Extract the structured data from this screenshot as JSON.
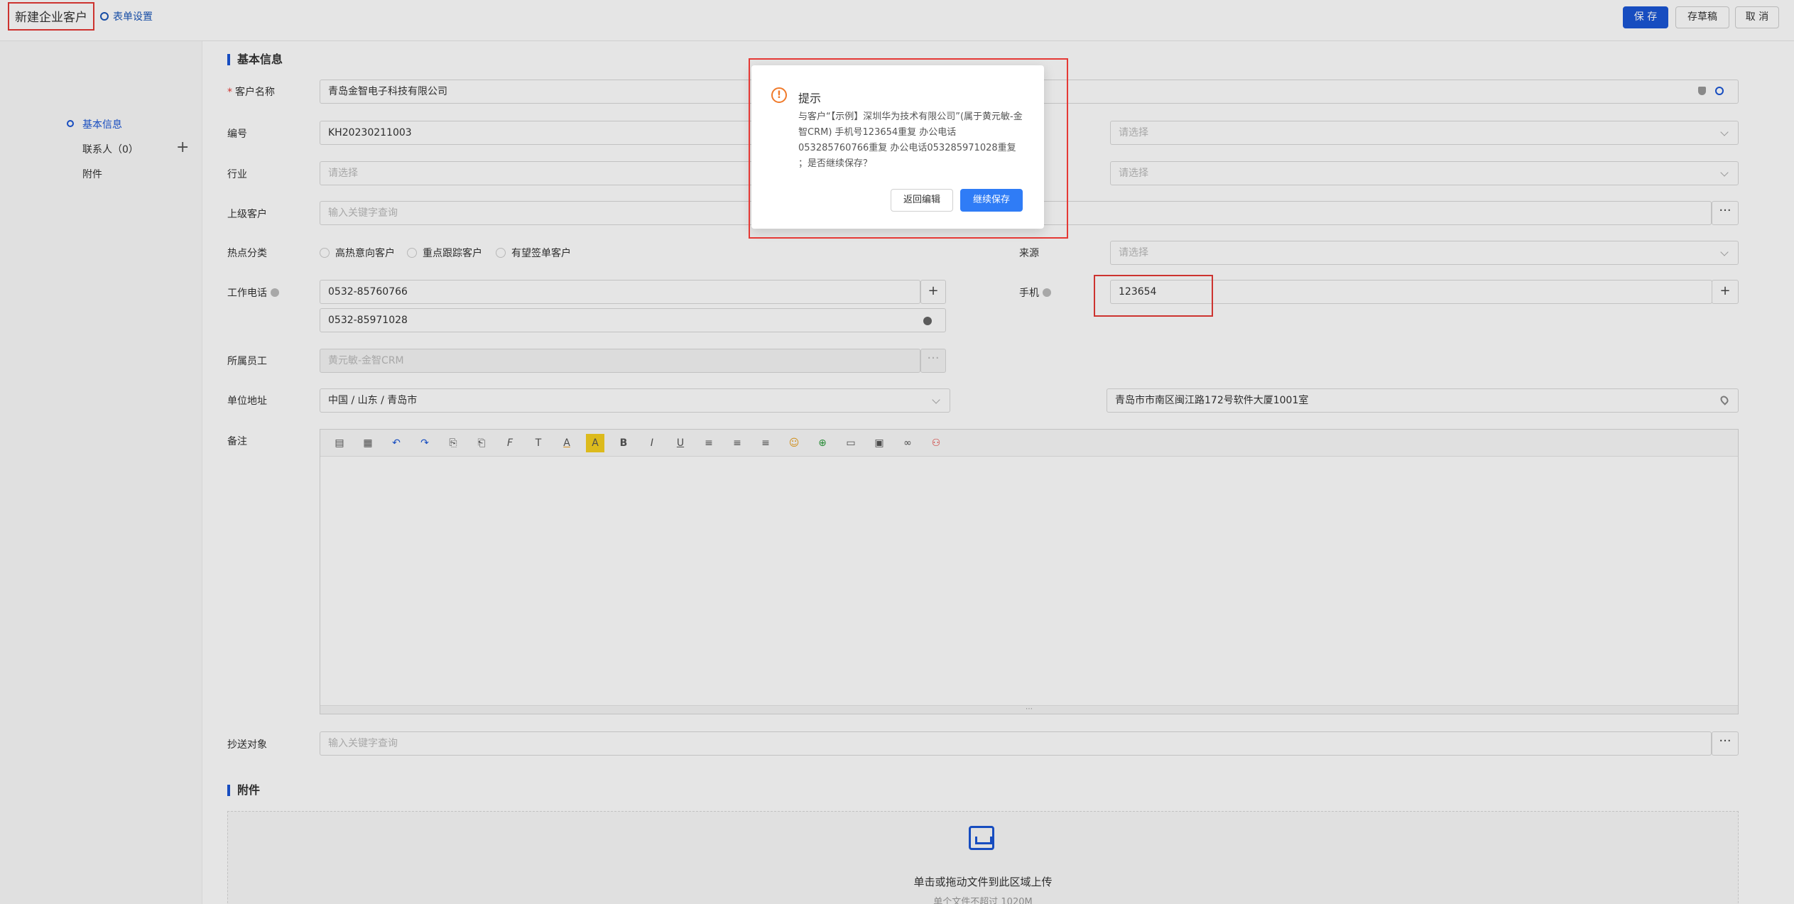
{
  "header": {
    "title": "新建企业客户",
    "form_settings": "表单设置",
    "save": "保 存",
    "draft": "存草稿",
    "cancel": "取 消"
  },
  "nav": {
    "basic": "基本信息",
    "contacts": "联系人（0）",
    "attachments": "附件",
    "add": "+"
  },
  "sections": {
    "basic": "基本信息",
    "attachments": "附件"
  },
  "form": {
    "customer_name": {
      "label": "客户名称",
      "value": "青岛金智电子科技有限公司"
    },
    "code": {
      "label": "编号",
      "value": "KH20230211003"
    },
    "industry": {
      "label": "行业",
      "placeholder": "请选择"
    },
    "parent": {
      "label": "上级客户",
      "placeholder": "输入关键字查询"
    },
    "hot_category": {
      "label": "热点分类",
      "options": [
        "高热意向客户",
        "重点跟踪客户",
        "有望签单客户"
      ]
    },
    "source": {
      "label": "来源",
      "placeholder": "请选择"
    },
    "right_select_1": {
      "placeholder": "请选择"
    },
    "right_select_2": {
      "placeholder": "请选择"
    },
    "work_phone": {
      "label": "工作电话",
      "values": [
        "0532-85760766",
        "0532-85971028"
      ]
    },
    "mobile": {
      "label": "手机",
      "value": "123654"
    },
    "owner": {
      "label": "所属员工",
      "value": "黄元敏-金智CRM"
    },
    "address": {
      "label": "单位地址",
      "region": "中国 / 山东 / 青岛市",
      "detail": "青岛市市南区闽江路172号软件大厦1001室"
    },
    "remark": {
      "label": "备注"
    },
    "cc": {
      "label": "抄送对象",
      "placeholder": "输入关键字查询"
    }
  },
  "editor_toolbar": [
    "▤",
    "▦",
    "↶",
    "↷",
    "⎘",
    "⎗",
    "F",
    "T",
    "A",
    "A",
    "B",
    "I",
    "U",
    "≡",
    "≡",
    "≡",
    "☺",
    "⊕",
    "▭",
    "▣",
    "∞",
    "⚇"
  ],
  "upload": {
    "text": "单击或拖动文件到此区域上传",
    "hint": "单个文件不超过 1020M"
  },
  "dialog": {
    "title": "提示",
    "message": "与客户“【示例】深圳华为技术有限公司”(属于黄元敏-金智CRM) 手机号123654重复 办公电话053285760766重复 办公电话053285971028重复 ；是否继续保存？",
    "back": "返回编辑",
    "continue": "继续保存"
  },
  "colors": {
    "primary": "#1a56d6",
    "dialog_primary": "#2f7cf6",
    "highlight": "#e53935",
    "warning": "#f07a2a"
  }
}
